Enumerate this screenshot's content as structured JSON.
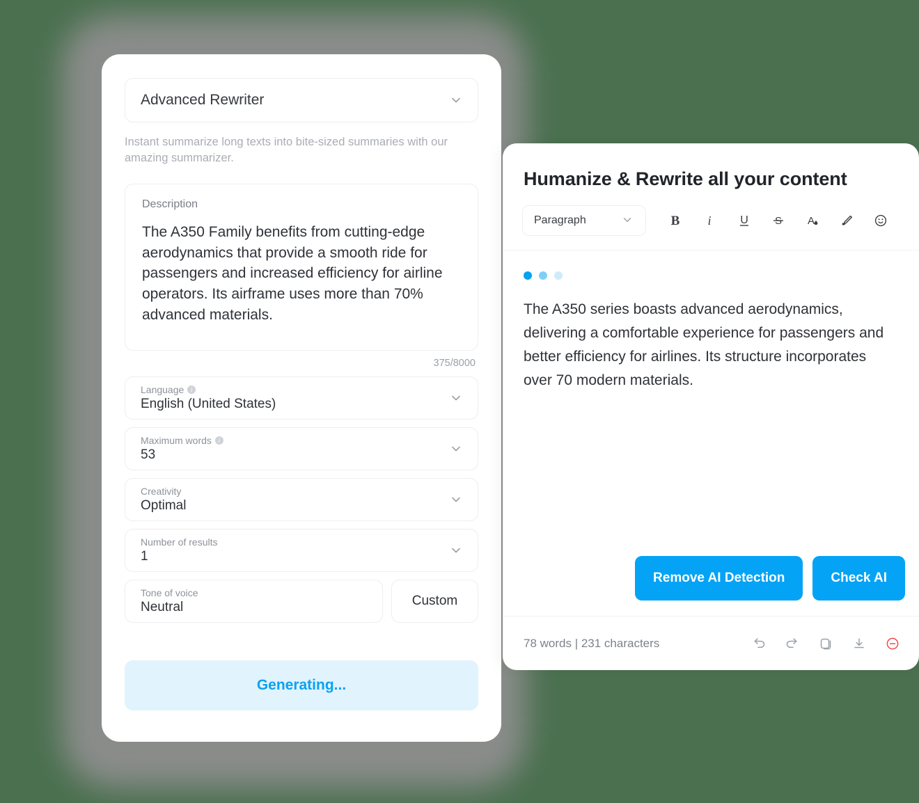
{
  "theme": {
    "background": "#4a704f",
    "accent": "#04a3f5",
    "accent_soft_bg": "#e1f3fd",
    "danger": "#f0484a",
    "card_bg": "#ffffff"
  },
  "left_panel": {
    "tool_selector": {
      "value": "Advanced Rewriter",
      "chevron": "chevron-down-icon"
    },
    "tool_description": "Instant summarize long texts into bite-sized summaries with our amazing summarizer.",
    "description_field": {
      "label": "Description",
      "value": "The A350 Family benefits from cutting-edge aerodynamics that provide a smooth ride for passengers and increased efficiency for airline operators. Its airframe uses more than 70% advanced materials.",
      "char_count": "375/8000"
    },
    "fields": [
      {
        "label": "Language",
        "value": "English (United States)",
        "has_info": true
      },
      {
        "label": "Maximum words",
        "value": "53",
        "has_info": true
      },
      {
        "label": "Creativity",
        "value": "Optimal",
        "has_info": false
      },
      {
        "label": "Number of results",
        "value": "1",
        "has_info": false
      }
    ],
    "tone": {
      "label": "Tone of voice",
      "value": "Neutral",
      "custom_button": "Custom"
    },
    "generate_button": "Generating..."
  },
  "right_panel": {
    "title": "Humanize & Rewrite all your content",
    "toolbar": {
      "block_style": "Paragraph",
      "buttons": [
        {
          "name": "bold",
          "glyph": "B"
        },
        {
          "name": "italic",
          "glyph": "i"
        },
        {
          "name": "underline",
          "glyph": "U"
        },
        {
          "name": "strikethrough",
          "glyph": "S"
        },
        {
          "name": "text-color",
          "glyph": "A"
        },
        {
          "name": "highlighter",
          "glyph": "pen"
        },
        {
          "name": "emoji",
          "glyph": "smiley"
        }
      ]
    },
    "loading_dots": 3,
    "result_text": "The A350 series boasts advanced aerodynamics, delivering a comfortable experience for passengers and better efficiency for airlines. Its structure incorporates over 70 modern materials.",
    "actions": [
      {
        "label": "Remove AI Detection"
      },
      {
        "label": "Check AI"
      }
    ],
    "footer": {
      "stats": "78 words | 231 characters",
      "icons": [
        "undo-icon",
        "redo-icon",
        "copy-icon",
        "download-icon",
        "delete-icon"
      ]
    }
  }
}
